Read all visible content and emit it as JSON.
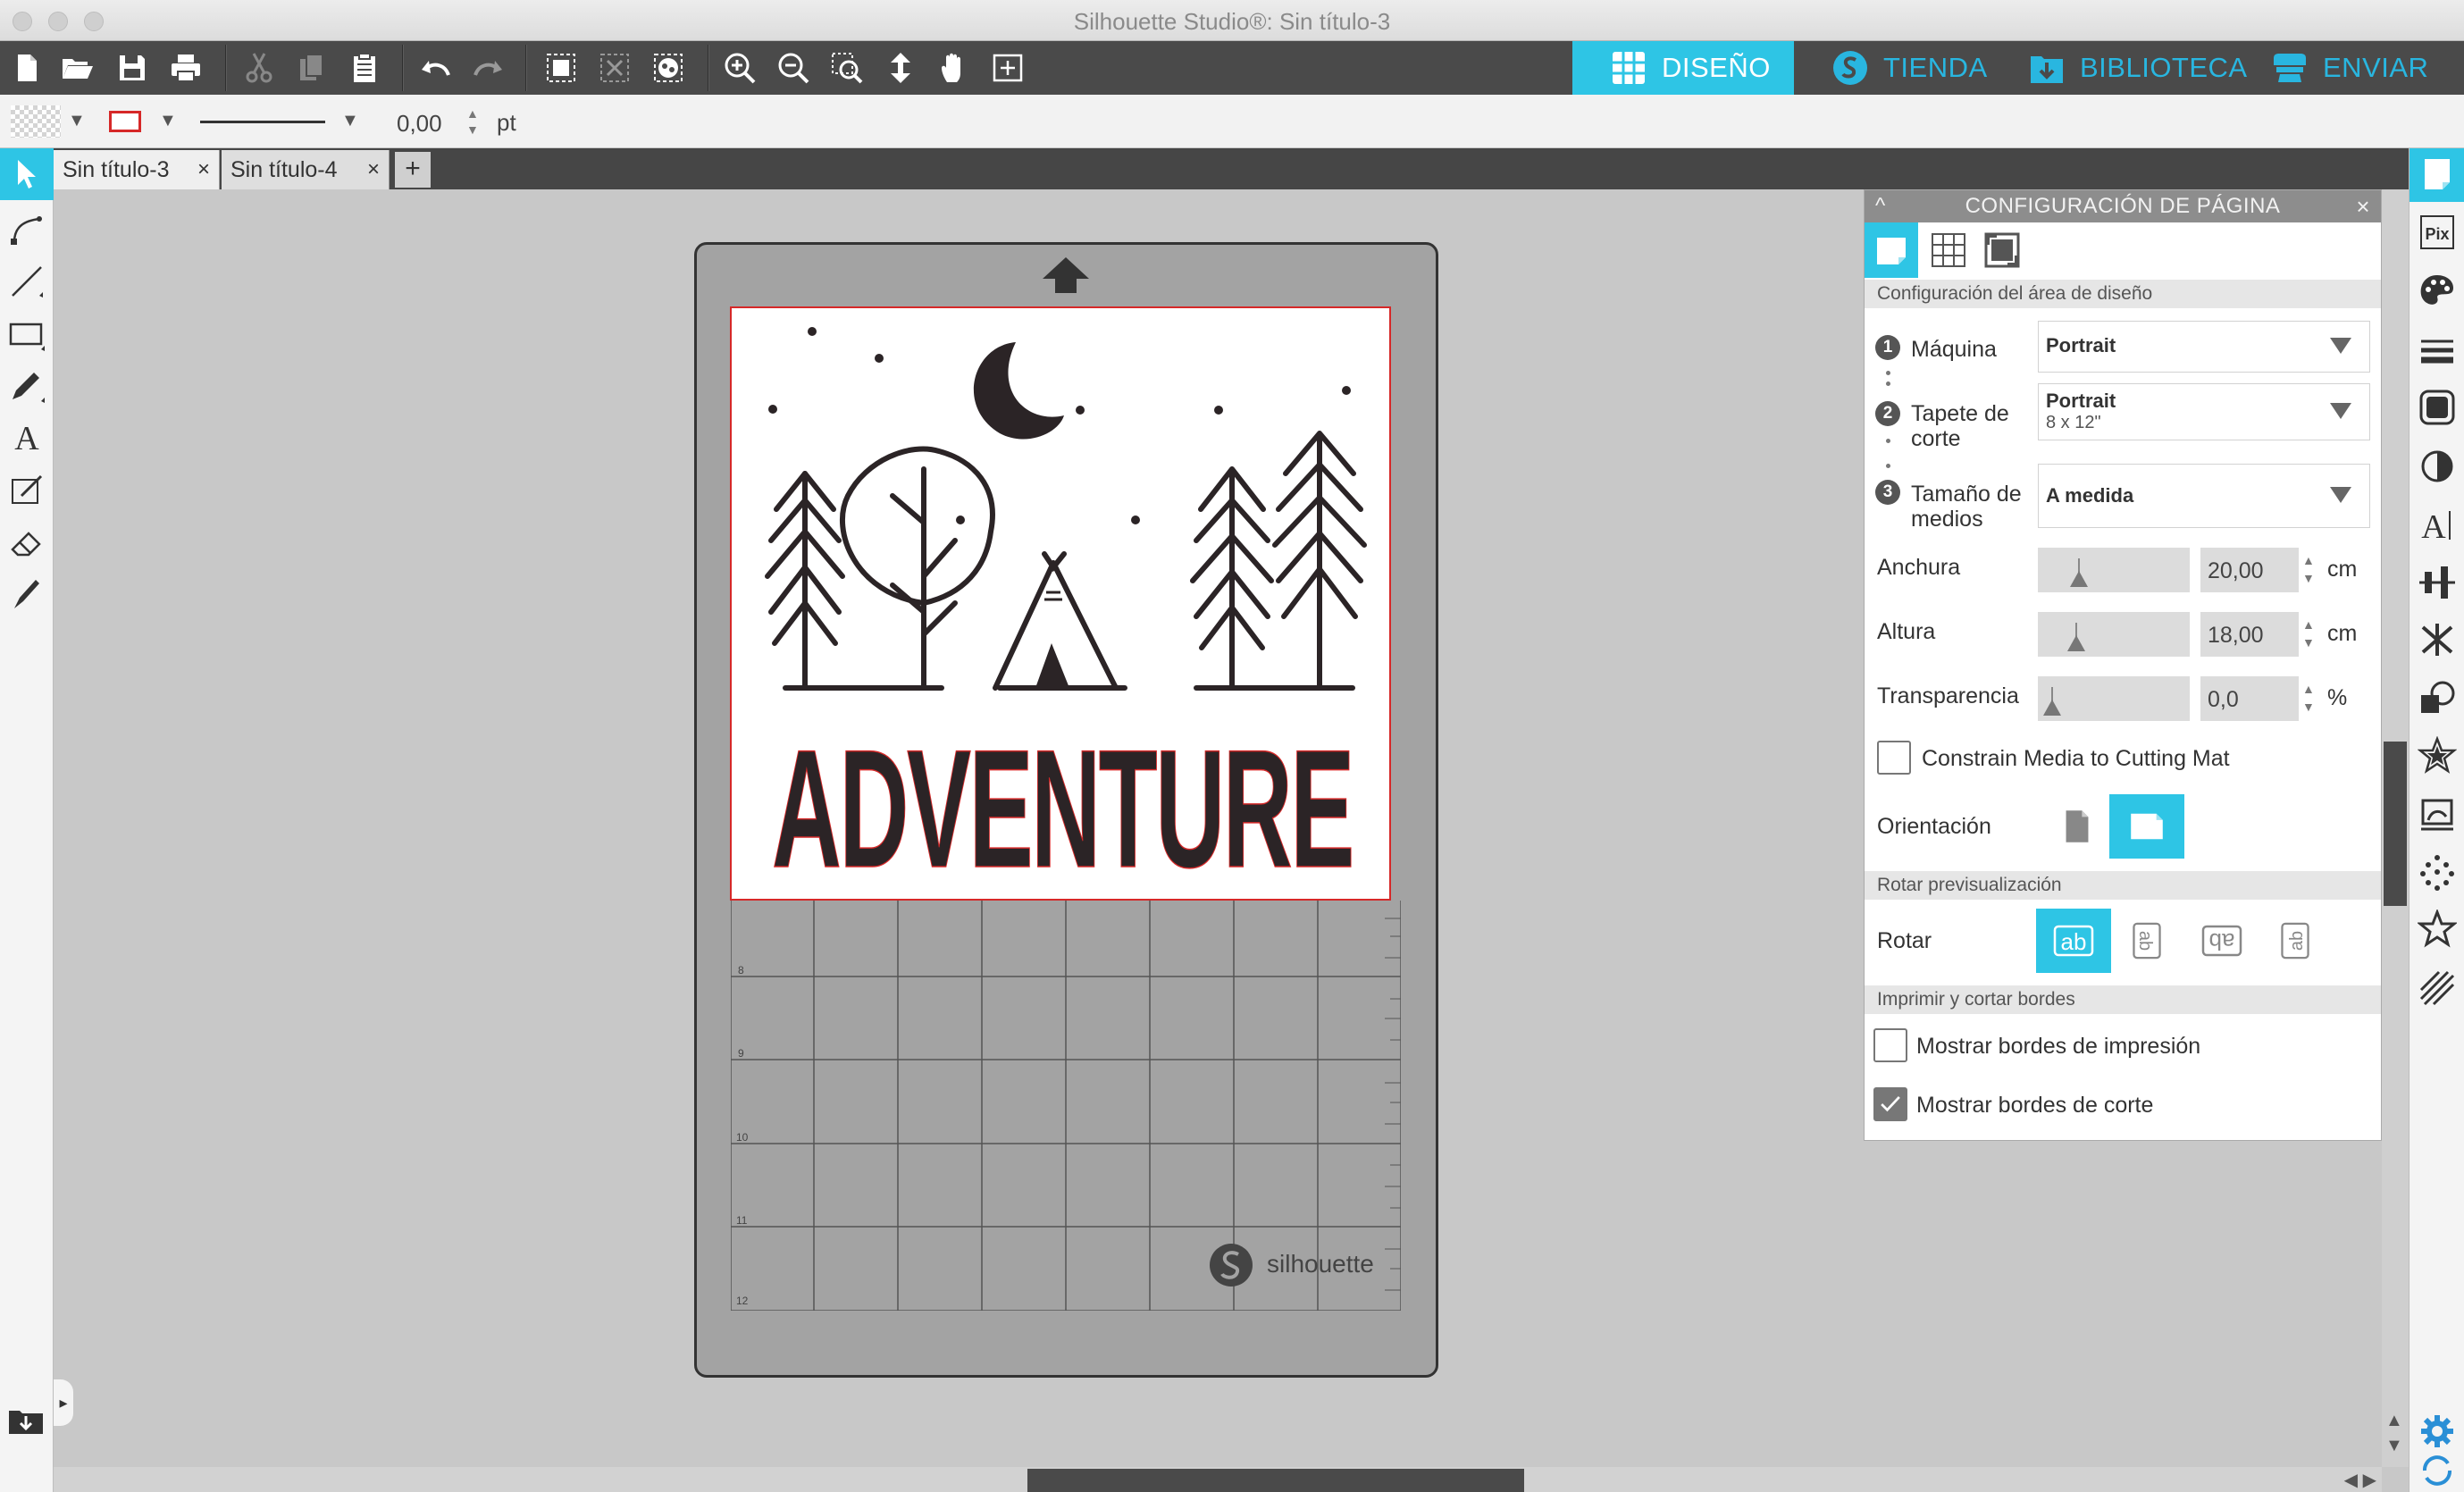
{
  "window": {
    "title": "Silhouette Studio®: Sin título-3"
  },
  "nav": [
    {
      "label": "DISEÑO",
      "icon": "grid-icon",
      "active": true
    },
    {
      "label": "TIENDA",
      "icon": "silhouette-s-icon",
      "active": false
    },
    {
      "label": "BIBLIOTECA",
      "icon": "library-download-icon",
      "active": false
    },
    {
      "label": "ENVIAR",
      "icon": "send-cutter-icon",
      "active": false
    }
  ],
  "options": {
    "line_width": "0,00",
    "line_unit": "pt"
  },
  "doc_tabs": [
    {
      "label": "Sin título-3",
      "active": true
    },
    {
      "label": "Sin título-4",
      "active": false
    }
  ],
  "add_tab_label": "+",
  "design": {
    "text": "ADVENTURE"
  },
  "mat": {
    "brand": "silhouette",
    "row_labels": [
      "8",
      "9",
      "10",
      "11",
      "12"
    ]
  },
  "panel": {
    "title": "CONFIGURACIÓN DE PÁGINA",
    "section_design": "Configuración del área de diseño",
    "machine": {
      "step": "1",
      "label": "Máquina",
      "value": "Portrait"
    },
    "mat": {
      "step": "2",
      "label": "Tapete de corte",
      "value": "Portrait",
      "sub": "8 x 12\""
    },
    "media": {
      "step": "3",
      "label": "Tamaño de medios",
      "value": "A medida"
    },
    "width": {
      "label": "Anchura",
      "value": "20,00",
      "unit": "cm",
      "level": 0.2
    },
    "height": {
      "label": "Altura",
      "value": "18,00",
      "unit": "cm",
      "level": 0.18
    },
    "transparency": {
      "label": "Transparencia",
      "value": "0,0",
      "unit": "%",
      "level": 0.0
    },
    "constrain": {
      "label": "Constrain Media to Cutting Mat",
      "checked": false
    },
    "orientation": {
      "label": "Orientación",
      "selected": "landscape"
    },
    "section_rotate": "Rotar previsualización",
    "rotate": {
      "label": "Rotar",
      "button_text": "ab",
      "selected": 0
    },
    "section_borders": "Imprimir y cortar bordes",
    "print_borders": {
      "label": "Mostrar bordes de impresión",
      "checked": false
    },
    "cut_borders": {
      "label": "Mostrar bordes de corte",
      "checked": true
    }
  },
  "colors": {
    "accent": "#2ec5e5",
    "toolbar": "#4a4a4a",
    "design": "#2b2426",
    "cut_line": "#d62828"
  }
}
